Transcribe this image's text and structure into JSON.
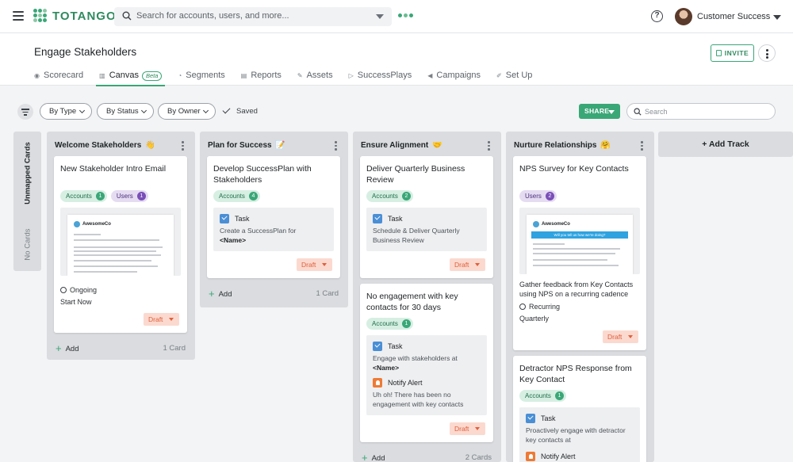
{
  "app": {
    "brand": "TOTANGO",
    "search_placeholder": "Search for accounts, users, and more...",
    "user_name": "Customer Success",
    "brand_color": "#3aa777",
    "icons": [
      "menu-icon",
      "search-icon",
      "chevron-down-icon",
      "help-icon",
      "avatar"
    ]
  },
  "page": {
    "title": "Engage Stakeholders",
    "invite_label": "INVITE",
    "tabs": [
      {
        "label": "Scorecard",
        "icon": "◉"
      },
      {
        "label": "Canvas",
        "icon": "▥",
        "badge": "Beta"
      },
      {
        "label": "Segments",
        "icon": "◔"
      },
      {
        "label": "Reports",
        "icon": "▤"
      },
      {
        "label": "Assets",
        "icon": "✎"
      },
      {
        "label": "SuccessPlays",
        "icon": "▷"
      },
      {
        "label": "Campaigns",
        "icon": "◀"
      },
      {
        "label": "Set Up",
        "icon": "✐"
      }
    ]
  },
  "filters": {
    "by_type": "By Type",
    "by_status": "By Status",
    "by_owner": "By Owner",
    "saved": "Saved",
    "share": "SHARE",
    "search_placeholder": "Search"
  },
  "board": {
    "unmapped_title": "Unmapped Cards",
    "unmapped_empty": "No Cards",
    "add_track": "+ Add Track",
    "add_label": "Add",
    "tracks": [
      {
        "title": "Welcome Stakeholders",
        "emoji": "👋",
        "count": "1 Card",
        "cards": [
          {
            "title": "New Stakeholder Intro Email",
            "chips": [
              {
                "label": "Accounts",
                "n": "1"
              },
              {
                "label": "Users",
                "n": "1"
              }
            ],
            "preview_brand": "AwesomeCo",
            "status": "Ongoing",
            "timing": "Start Now",
            "draft": "Draft"
          }
        ]
      },
      {
        "title": "Plan for Success",
        "emoji": "📝",
        "count": "1 Card",
        "cards": [
          {
            "title": "Develop SuccessPlan with Stakeholders",
            "chips": [
              {
                "label": "Accounts",
                "n": "4"
              }
            ],
            "steps": [
              {
                "type": "Task",
                "desc": "Create a SuccessPlan for",
                "bold": "<Name>"
              }
            ],
            "draft": "Draft"
          }
        ]
      },
      {
        "title": "Ensure Alignment",
        "emoji": "🤝",
        "count": "2 Cards",
        "cards": [
          {
            "title": "Deliver Quarterly Business Review",
            "chips": [
              {
                "label": "Accounts",
                "n": "2"
              }
            ],
            "steps": [
              {
                "type": "Task",
                "desc": "Schedule & Deliver Quarterly Business Review"
              }
            ],
            "draft": "Draft"
          },
          {
            "title": "No engagement with key contacts for 30 days",
            "chips": [
              {
                "label": "Accounts",
                "n": "1"
              }
            ],
            "steps": [
              {
                "type": "Task",
                "desc": "Engage with stakeholders at",
                "bold": "<Name>"
              },
              {
                "type": "Notify Alert",
                "desc": "Uh oh! There has been no engagement with key contacts"
              }
            ],
            "draft": "Draft"
          }
        ]
      },
      {
        "title": "Nurture Relationships",
        "emoji": "🤗",
        "cards": [
          {
            "title": "NPS Survey for Key Contacts",
            "chips": [
              {
                "label": "Users",
                "n": "2"
              }
            ],
            "preview_brand": "AwesomeCo",
            "preview_banner": "Will you tell us how we're doing?",
            "desc": "Gather feedback from Key Contacts using NPS on a recurring cadence",
            "status": "Recurring",
            "timing": "Quarterly",
            "draft": "Draft"
          },
          {
            "title": "Detractor NPS Response from Key Contact",
            "chips": [
              {
                "label": "Accounts",
                "n": "1"
              }
            ],
            "steps": [
              {
                "type": "Task",
                "desc": "Proactively engage with detractor key contacts at"
              },
              {
                "type": "Notify Alert"
              }
            ]
          }
        ]
      }
    ]
  }
}
